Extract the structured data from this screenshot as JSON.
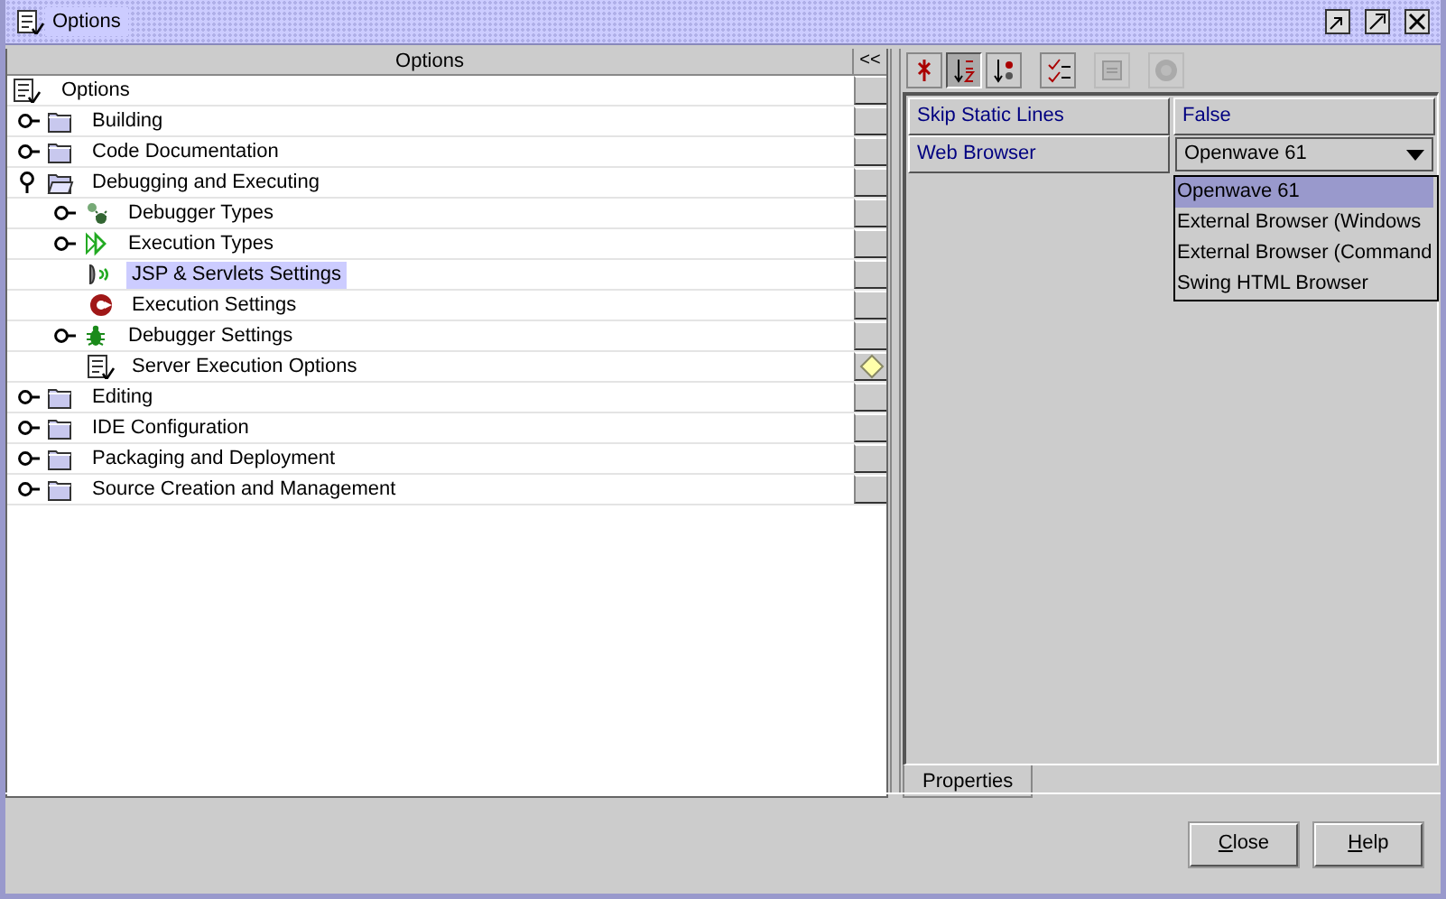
{
  "window": {
    "title": "Options"
  },
  "tree": {
    "header": "Options",
    "collapse_button": "<<",
    "root": {
      "label": "Options",
      "kind": "options",
      "selected": false,
      "marked": false,
      "children": [
        {
          "label": "Building",
          "kind": "folder",
          "expanded": false,
          "selected": false,
          "marked": false
        },
        {
          "label": "Code Documentation",
          "kind": "folder",
          "expanded": false,
          "selected": false,
          "marked": false
        },
        {
          "label": "Debugging and Executing",
          "kind": "folder",
          "expanded": true,
          "selected": false,
          "marked": false,
          "children": [
            {
              "label": "Debugger Types",
              "kind": "bugs",
              "expanded": false,
              "selected": false,
              "marked": false
            },
            {
              "label": "Execution Types",
              "kind": "play",
              "expanded": false,
              "selected": false,
              "marked": false
            },
            {
              "label": "JSP & Servlets Settings",
              "kind": "jsp",
              "selected": true,
              "marked": false
            },
            {
              "label": "Execution Settings",
              "kind": "exec",
              "selected": false,
              "marked": false
            },
            {
              "label": "Debugger Settings",
              "kind": "bug",
              "expanded": false,
              "selected": false,
              "marked": false
            },
            {
              "label": "Server Execution Options",
              "kind": "options",
              "selected": false,
              "marked": true
            }
          ]
        },
        {
          "label": "Editing",
          "kind": "folder",
          "expanded": false,
          "selected": false,
          "marked": false
        },
        {
          "label": "IDE Configuration",
          "kind": "folder",
          "expanded": false,
          "selected": false,
          "marked": false
        },
        {
          "label": "Packaging and Deployment",
          "kind": "folder",
          "expanded": false,
          "selected": false,
          "marked": false
        },
        {
          "label": "Source Creation and Management",
          "kind": "folder",
          "expanded": false,
          "selected": false,
          "marked": false
        }
      ]
    }
  },
  "toolbar": [
    {
      "kind": "unsorted",
      "pressed": false,
      "disabled": false
    },
    {
      "kind": "sort-name",
      "pressed": true,
      "disabled": false
    },
    {
      "kind": "sort-type",
      "pressed": false,
      "disabled": false
    },
    {
      "kind": "checklist",
      "pressed": false,
      "disabled": false
    },
    {
      "kind": "customize",
      "pressed": false,
      "disabled": true
    },
    {
      "kind": "help",
      "pressed": false,
      "disabled": true
    }
  ],
  "properties": [
    {
      "name": "Skip Static Lines",
      "value": "False",
      "kind": "text"
    },
    {
      "name": "Web Browser",
      "value": "Openwave 61",
      "kind": "combo",
      "expanded": true,
      "options": [
        {
          "label": "Openwave 61",
          "selected": true
        },
        {
          "label": "External Browser (Windows",
          "selected": false
        },
        {
          "label": "External Browser (Command",
          "selected": false
        },
        {
          "label": "Swing HTML Browser",
          "selected": false
        }
      ]
    }
  ],
  "tabs": [
    {
      "label": "Properties",
      "selected": true
    }
  ],
  "buttons": [
    {
      "label": "Close"
    },
    {
      "label": "Help"
    }
  ]
}
